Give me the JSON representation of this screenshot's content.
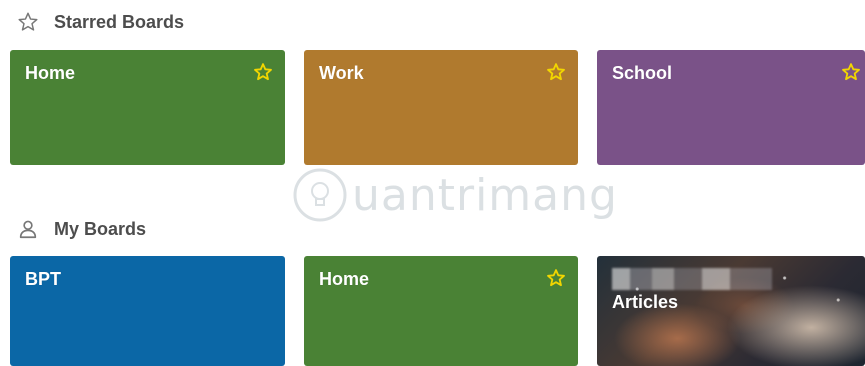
{
  "starred": {
    "title": "Starred Boards",
    "boards": [
      {
        "label": "Home",
        "color": "#4a8235",
        "starred": true
      },
      {
        "label": "Work",
        "color": "#b07a2e",
        "starred": true
      },
      {
        "label": "School",
        "color": "#7a5288",
        "starred": true
      }
    ]
  },
  "my_boards": {
    "title": "My Boards",
    "boards": [
      {
        "label": "BPT",
        "color": "#0b67a6",
        "starred": false
      },
      {
        "label": "Home",
        "color": "#4a8235",
        "starred": true
      },
      {
        "label": "Articles",
        "background": "photo",
        "starred": false
      }
    ]
  },
  "watermark": {
    "text": "uantrimang"
  },
  "colors": {
    "star": "#f2d600",
    "heading": "#4d4d4d"
  },
  "icons": {
    "starred_section": "star-outline-icon",
    "my_section": "person-icon",
    "board_star": "star-icon"
  }
}
